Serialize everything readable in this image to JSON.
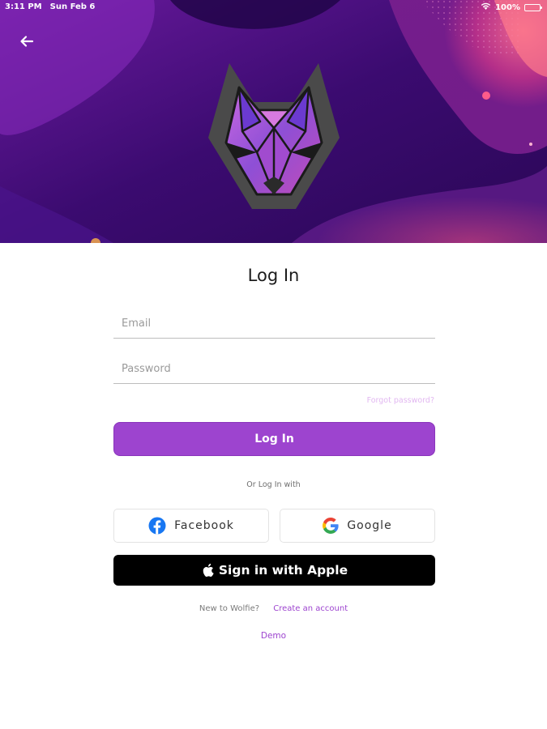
{
  "status_bar": {
    "time": "3:11 PM",
    "date": "Sun Feb 6",
    "battery": "100%"
  },
  "login": {
    "title": "Log In",
    "email_placeholder": "Email",
    "password_placeholder": "Password",
    "forgot_password": "Forgot password?",
    "submit_label": "Log In",
    "or_text": "Or Log In with",
    "facebook_label": "Facebook",
    "google_label": "Google",
    "apple_label": "Sign in with Apple",
    "new_prompt": "New to Wolfie?",
    "create_account": "Create an account",
    "demo": "Demo"
  },
  "colors": {
    "accent": "#9d44cf",
    "hero_bg": "#3a0a6b",
    "apple_button": "#000000"
  },
  "icons": {
    "back": "arrow-left-icon",
    "wifi": "wifi-icon",
    "battery": "battery-icon",
    "logo": "wolf-logo",
    "facebook": "facebook-icon",
    "google": "google-icon",
    "apple": "apple-icon"
  }
}
